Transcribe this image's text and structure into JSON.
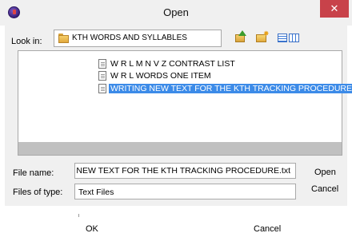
{
  "window": {
    "title": "Open",
    "close_label": "✕"
  },
  "lookin": {
    "label": "Look in:",
    "value": "KTH WORDS AND SYLLABLES"
  },
  "toolbar": {
    "up_icon": "folder-up-icon",
    "new_folder_icon": "new-folder-icon",
    "view_icon": "view-menu-icon"
  },
  "files": [
    {
      "name": "W R L M N V Z CONTRAST LIST",
      "selected": false
    },
    {
      "name": "W R L WORDS ONE ITEM",
      "selected": false
    },
    {
      "name": "WRITING NEW TEXT FOR THE KTH TRACKING PROCEDURE",
      "selected": true
    }
  ],
  "filename": {
    "label": "File name:",
    "value": "RITING NEW TEXT FOR THE KTH TRACKING PROCEDURE.txt"
  },
  "filetype": {
    "label": "Files of type:",
    "value": "Text Files"
  },
  "buttons": {
    "open": "Open",
    "cancel": "Cancel"
  },
  "bottom": {
    "ok": "OK",
    "cancel": "Cancel"
  },
  "colors": {
    "selection": "#3c8be8",
    "close": "#c8424a",
    "dialog_bg": "#f0f0f0"
  }
}
